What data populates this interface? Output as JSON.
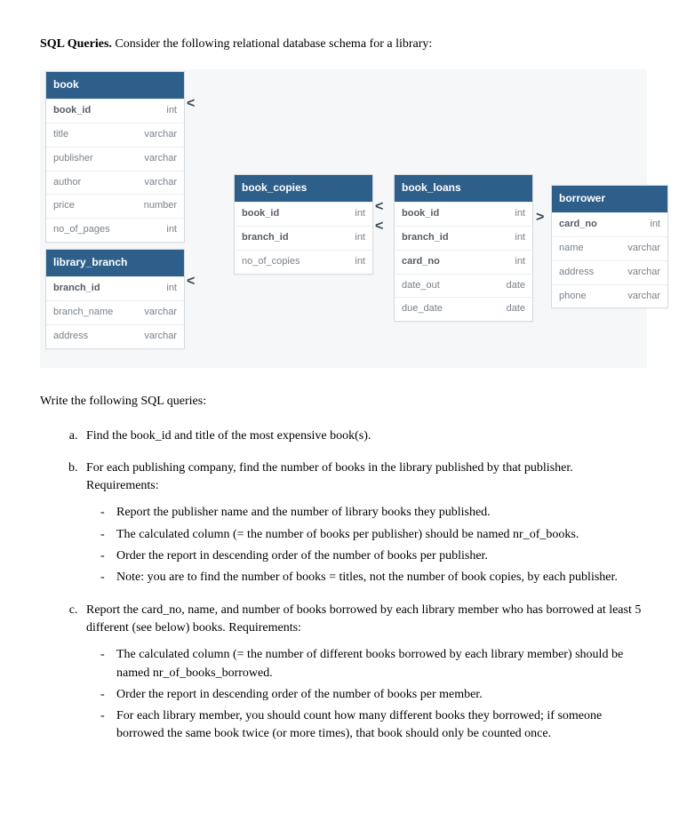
{
  "intro_bold": "SQL Queries.",
  "intro_rest": " Consider the following relational database schema for a library:",
  "tables": {
    "book": {
      "name": "book",
      "fields": [
        {
          "col": "book_id",
          "type": "int",
          "bold": true
        },
        {
          "col": "title",
          "type": "varchar"
        },
        {
          "col": "publisher",
          "type": "varchar"
        },
        {
          "col": "author",
          "type": "varchar"
        },
        {
          "col": "price",
          "type": "number"
        },
        {
          "col": "no_of_pages",
          "type": "int"
        }
      ]
    },
    "library_branch": {
      "name": "library_branch",
      "fields": [
        {
          "col": "branch_id",
          "type": "int",
          "bold": true
        },
        {
          "col": "branch_name",
          "type": "varchar"
        },
        {
          "col": "address",
          "type": "varchar"
        }
      ]
    },
    "book_copies": {
      "name": "book_copies",
      "fields": [
        {
          "col": "book_id",
          "type": "int",
          "bold": true
        },
        {
          "col": "branch_id",
          "type": "int",
          "bold": true
        },
        {
          "col": "no_of_copies",
          "type": "int"
        }
      ]
    },
    "book_loans": {
      "name": "book_loans",
      "fields": [
        {
          "col": "book_id",
          "type": "int",
          "bold": true
        },
        {
          "col": "branch_id",
          "type": "int",
          "bold": true
        },
        {
          "col": "card_no",
          "type": "int",
          "bold": true
        },
        {
          "col": "date_out",
          "type": "date"
        },
        {
          "col": "due_date",
          "type": "date"
        }
      ]
    },
    "borrower": {
      "name": "borrower",
      "fields": [
        {
          "col": "card_no",
          "type": "int",
          "bold": true
        },
        {
          "col": "name",
          "type": "varchar"
        },
        {
          "col": "address",
          "type": "varchar"
        },
        {
          "col": "phone",
          "type": "varchar"
        }
      ]
    }
  },
  "queries_intro": "Write the following SQL queries:",
  "qa": "Find the book_id and title of the most expensive book(s).",
  "qb": "For each publishing company, find the number of books in the library published by that publisher. Requirements:",
  "qb_sub": [
    "Report the publisher name and the number of library books they published.",
    "The calculated column (= the number of books per publisher) should be named nr_of_books.",
    "Order the report in descending order of the number of books per publisher.",
    "Note: you are to find the number of books = titles, not the number of book copies, by each publisher."
  ],
  "qc": "Report the card_no, name, and number of books borrowed by each library member who has borrowed at least 5 different (see below) books. Requirements:",
  "qc_sub": [
    "The calculated column (= the number of different books borrowed by each library member) should be named nr_of_books_borrowed.",
    "Order the report in descending order of the number of books per member.",
    "For each library member, you should count how many different books they borrowed; if someone borrowed the same book twice (or more times), that book should only be counted once."
  ]
}
